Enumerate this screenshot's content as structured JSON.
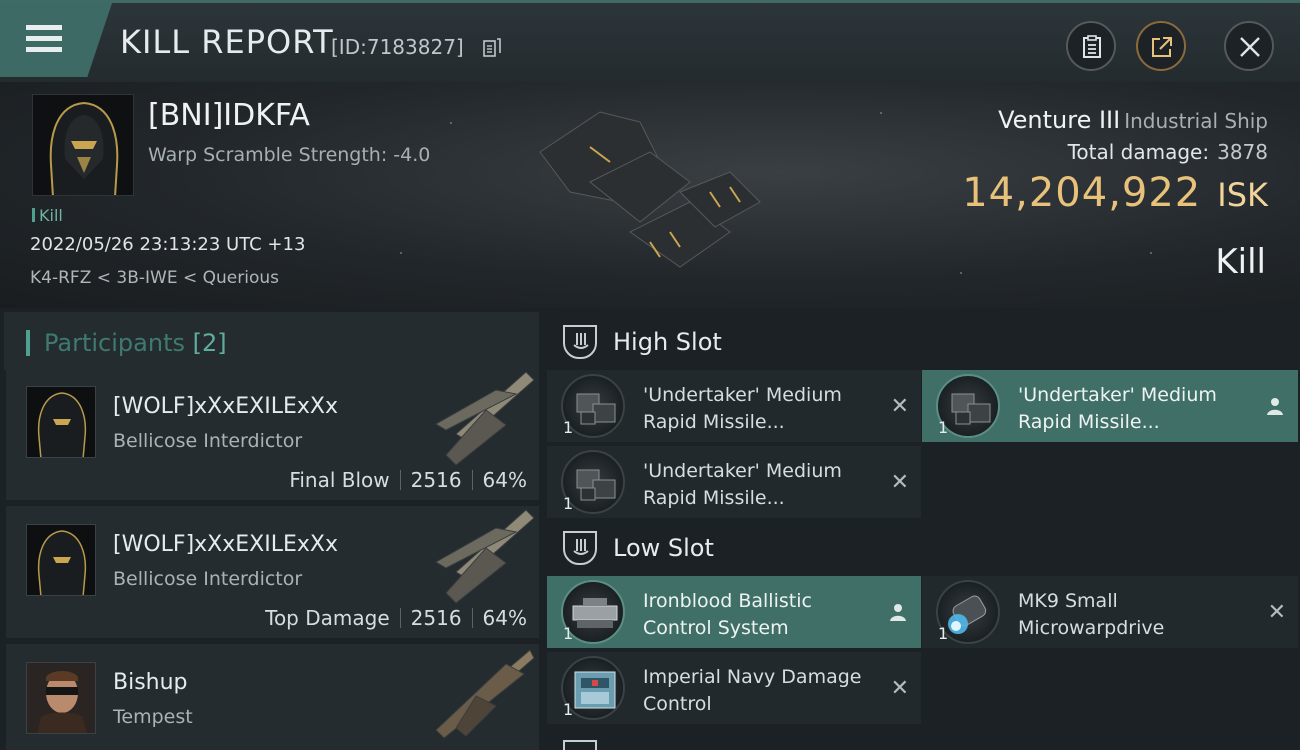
{
  "header": {
    "title": "KILL REPORT",
    "id_label": "[ID:7183827]"
  },
  "victim": {
    "name": "[BNI]IDKFA",
    "warp_scramble": "Warp Scramble Strength: -4.0",
    "kill_tag": "Kill",
    "date": "2022/05/26 23:13:23 UTC +13",
    "location": "K4-RFZ < 3B-IWE < Querious",
    "ship_name": "Venture III",
    "ship_class": "Industrial Ship",
    "total_damage_label": "Total damage:",
    "total_damage": "3878",
    "isk_amount": "14,204,922",
    "isk_currency": "ISK",
    "result": "Kill"
  },
  "participants": {
    "title": "Participants",
    "count": "[2]",
    "rows": [
      {
        "name": "[WOLF]xXxEXILExXx",
        "ship": "Bellicose Interdictor",
        "tag": "Final Blow",
        "damage": "2516",
        "percent": "64%"
      },
      {
        "name": "[WOLF]xXxEXILExXx",
        "ship": "Bellicose Interdictor",
        "tag": "Top Damage",
        "damage": "2516",
        "percent": "64%"
      },
      {
        "name": "Bishup",
        "ship": "Tempest"
      }
    ]
  },
  "fittings": {
    "high_slot": {
      "title": "High Slot",
      "items": [
        {
          "qty": "1",
          "name": "'Undertaker' Medium Rapid Missile..."
        },
        {
          "qty": "1",
          "name": "'Undertaker' Medium Rapid Missile..."
        },
        {
          "qty": "1",
          "name": "'Undertaker' Medium Rapid Missile..."
        }
      ]
    },
    "low_slot": {
      "title": "Low Slot",
      "items": [
        {
          "qty": "1",
          "name": "Ironblood Ballistic Control System"
        },
        {
          "qty": "1",
          "name": "MK9 Small Microwarpdrive"
        },
        {
          "qty": "1",
          "name": "Imperial Navy Damage Control"
        }
      ]
    }
  },
  "colors": {
    "accent": "#3f6f67",
    "isk_gold": "#e8c27a",
    "background": "#14181b"
  }
}
